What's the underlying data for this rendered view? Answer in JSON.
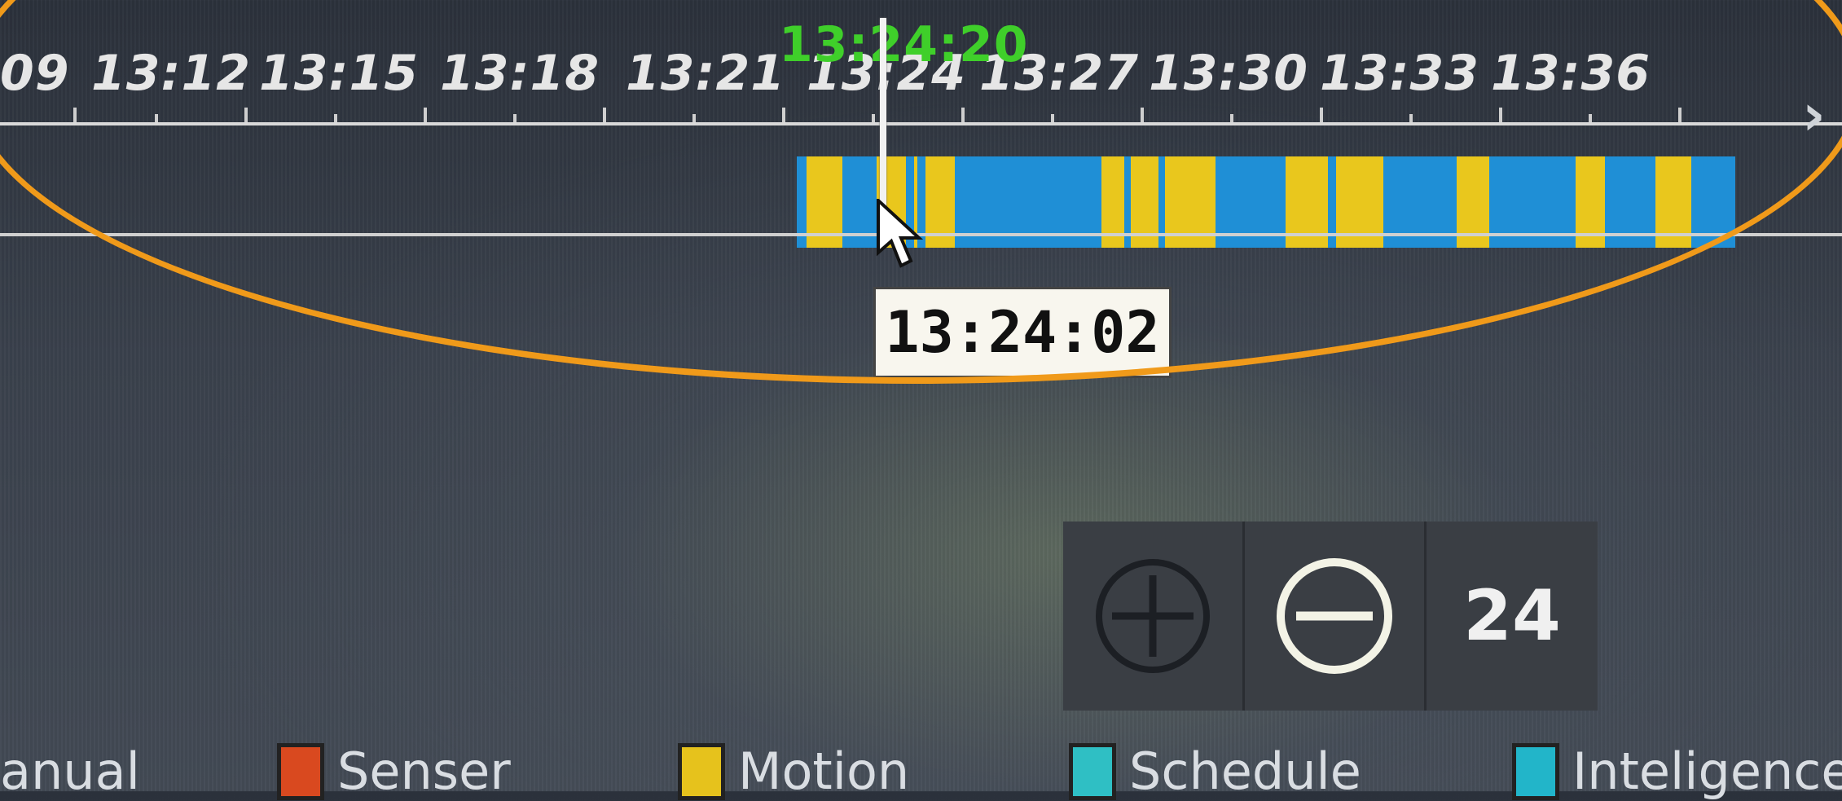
{
  "timeline": {
    "tick_labels": [
      "09",
      "13:12",
      "13:15",
      "13:18",
      "13:21",
      "13:24",
      "13:27",
      "13:30",
      "13:33",
      "13:36"
    ],
    "current_time": "13:24:20",
    "hover_time": "13:24:02",
    "next_icon": "chevron-right-icon"
  },
  "zoom": {
    "zoom_in_icon": "zoom-in-icon",
    "zoom_out_icon": "zoom-out-icon",
    "level": "24"
  },
  "legend": {
    "items": [
      {
        "label": "anual",
        "color": "",
        "icon": ""
      },
      {
        "label": "Senser",
        "color": "#d9491f"
      },
      {
        "label": "Motion",
        "color": "#e6c21c"
      },
      {
        "label": "Schedule",
        "color": "#2fbfc4"
      },
      {
        "label": "Inteligence",
        "color": "#22b5c9"
      }
    ]
  },
  "colors": {
    "motion": "#e9c71d",
    "intelligence": "#1f8fd6",
    "current_time": "#3fcf2a",
    "highlight": "#f09a1a"
  }
}
